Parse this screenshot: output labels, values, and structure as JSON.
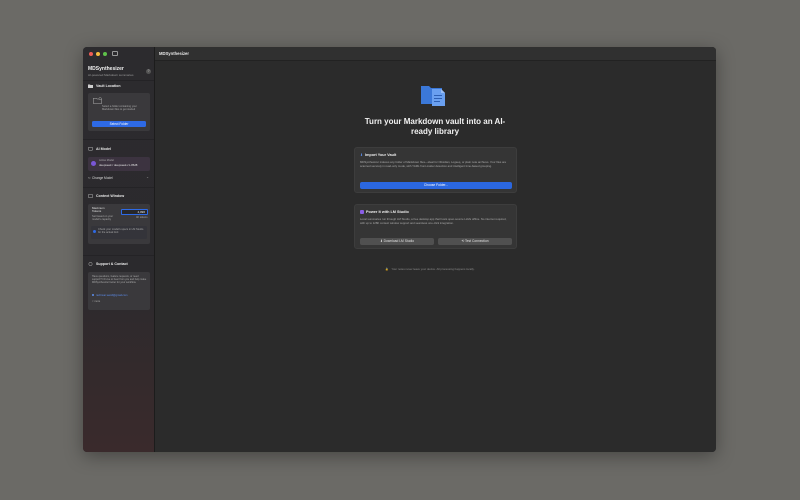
{
  "window": {
    "title": "MDSynthesizer"
  },
  "colors": {
    "accent": "#2e6ae6",
    "traffic_close": "#ee5c55",
    "traffic_min": "#f4bb3f",
    "traffic_max": "#5ec24a"
  },
  "sidebar": {
    "app_title": "MDSynthesizer",
    "app_subtitle": "AI-powered Markdown summaries",
    "help_glyph": "?",
    "vault": {
      "heading": "Vault Location",
      "description": "Select a folder containing your Markdown files to get started",
      "button": "Select Folder"
    },
    "model": {
      "heading": "AI Model",
      "active_label": "Active Model",
      "active_value": "deepseek / deepseek-r1-0528",
      "change_label": "Change Model"
    },
    "context": {
      "heading": "Context Window",
      "max_label": "Maximum Tokens",
      "max_desc": "Set based on your model's capacity",
      "tokens_value": "4,096",
      "tokens_unit": "4K tokens",
      "hint": "Check your model's specs in LM Studio for the actual limit"
    },
    "support": {
      "heading": "Support & Contact",
      "description": "Have questions, feature requests, or need support? I'd love to hear from you and help make MDSynthesizer better for your workflow.",
      "email": "rechman.weird@gmail.com",
      "more": "< more"
    }
  },
  "main": {
    "hero_title": "Turn your Markdown vault into an AI-ready library",
    "import_panel": {
      "heading": "Import Your Vault",
      "body": "MDSynthesizer indexes any folder of Markdown files—ideal for Obsidian, Logseq, or plain note archives. Your files are scanned securely in read-only mode, with YAML front-matter detection and intelligent time-based grouping.",
      "button": "Choose Folder..."
    },
    "power_panel": {
      "heading": "Power It with LM Studio",
      "body": "Local summaries run through LM Studio, a free desktop app that hosts open-source LLMs offline. No internet required, with up to 128K context window support and seamless one-click integration.",
      "download_button": "Download LM Studio",
      "test_button": "Test Connection"
    },
    "footer_note": "Your notes never leave your device. All processing happens locally."
  }
}
